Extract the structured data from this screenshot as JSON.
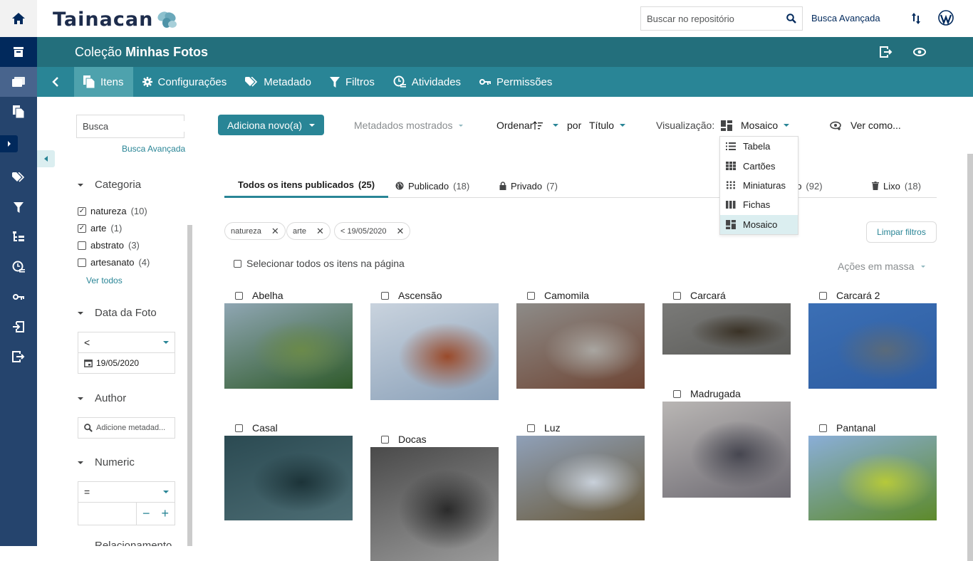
{
  "app": {
    "logo_text": "Tainacan"
  },
  "topbar": {
    "search_placeholder": "Buscar no repositório",
    "advanced_search_label": "Busca Avançada",
    "icons": [
      "processes-icon",
      "wordpress-icon"
    ]
  },
  "rail": {
    "items": [
      "home-icon",
      "collections-icon",
      "items-icon",
      "items-alt-icon",
      "expand-icon",
      "metadata-icon",
      "filters-icon",
      "taxonomies-icon",
      "activities-icon",
      "capabilities-icon",
      "importers-icon",
      "exporters-icon"
    ]
  },
  "collection": {
    "prefix": "Coleção",
    "name": "Minhas Fotos",
    "actions": [
      "exit-icon",
      "view-icon"
    ]
  },
  "nav_tabs": [
    {
      "label": "Itens",
      "icon": "items-icon",
      "active": true
    },
    {
      "label": "Configurações",
      "icon": "gear-icon",
      "active": false
    },
    {
      "label": "Metadado",
      "icon": "tags-icon",
      "active": false
    },
    {
      "label": "Filtros",
      "icon": "filter-icon",
      "active": false
    },
    {
      "label": "Atividades",
      "icon": "activities-icon",
      "active": false
    },
    {
      "label": "Permissões",
      "icon": "key-icon",
      "active": false
    }
  ],
  "filters": {
    "search_placeholder": "Busca",
    "advanced_search_label": "Busca Avançada",
    "categoria": {
      "label": "Categoria",
      "options": [
        {
          "label": "natureza",
          "count": "(10)",
          "checked": true
        },
        {
          "label": "arte",
          "count": "(1)",
          "checked": true
        },
        {
          "label": "abstrato",
          "count": "(3)",
          "checked": false
        },
        {
          "label": "artesanato",
          "count": "(4)",
          "checked": false
        }
      ],
      "see_all": "Ver todos"
    },
    "data_foto": {
      "label": "Data da Foto",
      "comparator": "<",
      "date": "19/05/2020"
    },
    "author": {
      "label": "Author",
      "placeholder": "Adicione metadad..."
    },
    "numeric": {
      "label": "Numeric",
      "comparator": "=",
      "value": "",
      "minus": "−",
      "plus": "+"
    },
    "next_label_partial": "Relacionamento"
  },
  "toolbar": {
    "add_new_label": "Adiciona novo(a)",
    "displayed_metadata_label": "Metadados mostrados",
    "sort_label": "Ordenar",
    "by_label": "por",
    "sort_field": "Título",
    "view_label": "Visualização:",
    "view_mode": "Mosaico",
    "view_as_label": "Ver como..."
  },
  "view_modes_dropdown": [
    {
      "label": "Tabela",
      "icon": "list-icon",
      "selected": false
    },
    {
      "label": "Cartões",
      "icon": "cards-icon",
      "selected": false
    },
    {
      "label": "Miniaturas",
      "icon": "thumbnails-icon",
      "selected": false
    },
    {
      "label": "Fichas",
      "icon": "records-icon",
      "selected": false
    },
    {
      "label": "Mosaico",
      "icon": "masonry-icon",
      "selected": true
    }
  ],
  "status_tabs": [
    {
      "label": "Todos os itens publicados",
      "count": "(25)",
      "active": true
    },
    {
      "label": "Publicado",
      "count": "(18)",
      "icon": "globe-icon"
    },
    {
      "label": "Privado",
      "count": "(7)",
      "icon": "lock-icon"
    },
    {
      "label": "Rascunho",
      "visible_label": "cunho",
      "count": "(92)"
    },
    {
      "label": "Lixo",
      "count": "(18)",
      "icon": "trash-icon"
    }
  ],
  "active_filters": [
    {
      "label": "natureza"
    },
    {
      "label": "arte"
    },
    {
      "label": "< 19/05/2020"
    }
  ],
  "clear_filters_label": "Limpar filtros",
  "select_all_label": "Selecionar todos os itens na página",
  "bulk_actions_label": "Ações em massa",
  "items": [
    {
      "title": "Abelha",
      "colors": [
        "#8fa6b3",
        "#2f5a2a",
        "#6b8a4a"
      ]
    },
    {
      "title": "Ascensão",
      "colors": [
        "#c9d3de",
        "#8aa0b8",
        "#9a4a2a"
      ]
    },
    {
      "title": "Camomila",
      "colors": [
        "#8d8b88",
        "#6e4534",
        "#a9a6a1"
      ]
    },
    {
      "title": "Carcará",
      "colors": [
        "#7a7a78",
        "#5b5b58",
        "#3a3226"
      ]
    },
    {
      "title": "Carcará 2",
      "colors": [
        "#3b6fb5",
        "#2d5ca0",
        "#5a6a7a"
      ]
    },
    {
      "title": "Casal",
      "colors": [
        "#2b4a52",
        "#4d6d74",
        "#1c3338"
      ]
    },
    {
      "title": "Docas",
      "colors": [
        "#4a4a4a",
        "#9a9a9a",
        "#2a2a2a"
      ]
    },
    {
      "title": "Luz",
      "colors": [
        "#8fa0b8",
        "#6a5a3a",
        "#c8d0da"
      ]
    },
    {
      "title": "Madrugada",
      "colors": [
        "#b9b6b4",
        "#6d6a72",
        "#464650"
      ]
    },
    {
      "title": "Pantanal",
      "colors": [
        "#8aaed8",
        "#5d8a2a",
        "#b6c93a"
      ]
    }
  ]
}
